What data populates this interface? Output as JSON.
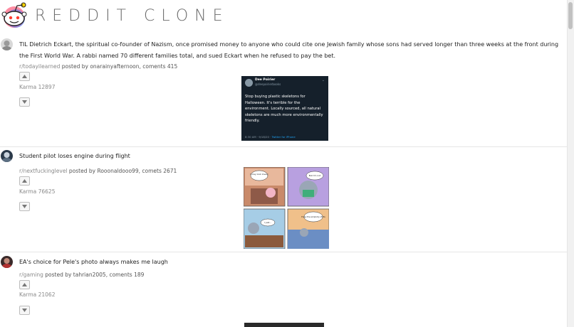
{
  "app": {
    "title": "REDDIT CLONE"
  },
  "posts": [
    {
      "title": "TIL Dietrich Eckart, the spiritual co-founder of Nazism, once promised money to anyone who could cite one Jewish family whose sons had served longer than three weeks at the front during the First World War. A rabbi named 70 different families total, and sued Eckart when he refused to pay the bet.",
      "subreddit": "r/todayilearned",
      "posted_by_prefix": " posted by onarainyafternoon, coments 415",
      "karma": "Karma 12897",
      "image": {
        "name": "Dee Poirier",
        "handle": "@deepoirierbooks",
        "text": "Stop buying plastic skeletons for Halloween. It's terrible for the environment. Locally sourced, all natural skeletons are much more environmentally friendly.",
        "time": "8:30 AM · 9/18/20 · ",
        "source": "Twitter for iPhone"
      }
    },
    {
      "title": "Student pilot loses engine during flight",
      "subreddit": "r/nextfuckinglevel",
      "posted_by_prefix": " posted by Rooonaldooo99, comets 2671",
      "karma": "Karma 76625",
      "image": {
        "panel1": "I may look lovely",
        "panel2": "But I'm not",
        "panel3": "I just...",
        "panel4": "Enjoy the simplicity of life"
      }
    },
    {
      "title": "EA's choice for Pele's photo always makes me laugh",
      "subreddit": "r/gaming",
      "posted_by_prefix": " posted by tahrian2005, coments 189",
      "karma": "Karma 21062"
    }
  ],
  "colors": {
    "title": "#6b6b6b",
    "tweet_bg": "#15202b",
    "brand": "#ff4500"
  }
}
